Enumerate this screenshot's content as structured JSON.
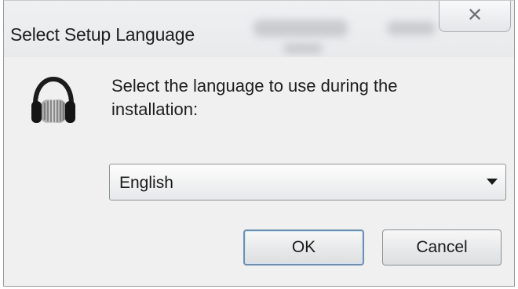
{
  "window": {
    "title": "Select Setup Language",
    "close_glyph": "✕"
  },
  "content": {
    "icon": "headphones-icon",
    "prompt": "Select the language to use during the installation:"
  },
  "language_select": {
    "selected": "English"
  },
  "buttons": {
    "ok_label": "OK",
    "cancel_label": "Cancel"
  }
}
